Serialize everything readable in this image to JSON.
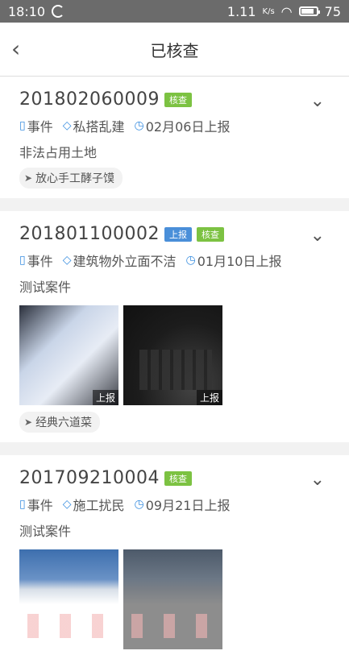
{
  "status_bar": {
    "time": "18:10",
    "net_speed": "1.11",
    "speed_unit": "K/s",
    "battery": "75"
  },
  "header": {
    "title": "已核查"
  },
  "cases": [
    {
      "case_no": "201802060009",
      "tags": [
        {
          "label": "核查",
          "kind": "verified"
        }
      ],
      "type": "事件",
      "category": "私搭乱建",
      "date": "02月06日上报",
      "description": "非法占用土地",
      "location": "放心手工酵子馍",
      "photos": []
    },
    {
      "case_no": "201801100002",
      "tags": [
        {
          "label": "上报",
          "kind": "reported"
        },
        {
          "label": "核查",
          "kind": "verified"
        }
      ],
      "type": "事件",
      "category": "建筑物外立面不洁",
      "date": "01月10日上报",
      "description": "测试案件",
      "location": "经典六道菜",
      "photos": [
        {
          "badge": "上报"
        },
        {
          "badge": "上报"
        }
      ]
    },
    {
      "case_no": "201709210004",
      "tags": [
        {
          "label": "核查",
          "kind": "verified"
        }
      ],
      "type": "事件",
      "category": "施工扰民",
      "date": "09月21日上报",
      "description": "测试案件",
      "location": "",
      "photos": [
        {
          "badge": ""
        },
        {
          "badge": ""
        }
      ]
    }
  ]
}
